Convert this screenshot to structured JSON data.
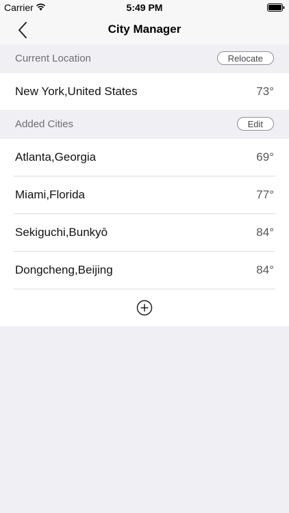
{
  "status_bar": {
    "carrier": "Carrier",
    "time": "5:49 PM",
    "wifi_icon": "wifi-icon",
    "battery_icon": "battery-icon"
  },
  "nav": {
    "back_icon": "chevron-left-icon",
    "title": "City Manager"
  },
  "current_location": {
    "header": "Current Location",
    "action_label": "Relocate",
    "city": {
      "name": "New York,United States",
      "temp": "73°"
    }
  },
  "added_cities": {
    "header": "Added Cities",
    "action_label": "Edit",
    "items": [
      {
        "name": "Atlanta,Georgia",
        "temp": "69°"
      },
      {
        "name": "Miami,Florida",
        "temp": "77°"
      },
      {
        "name": "Sekiguchi,Bunkyō",
        "temp": "84°"
      },
      {
        "name": "Dongcheng,Beijing",
        "temp": "84°"
      }
    ],
    "add_icon": "plus-circle-icon"
  },
  "colors": {
    "background": "#efeff4",
    "bar": "#f7f7f7",
    "section_text": "#6d6d72"
  }
}
